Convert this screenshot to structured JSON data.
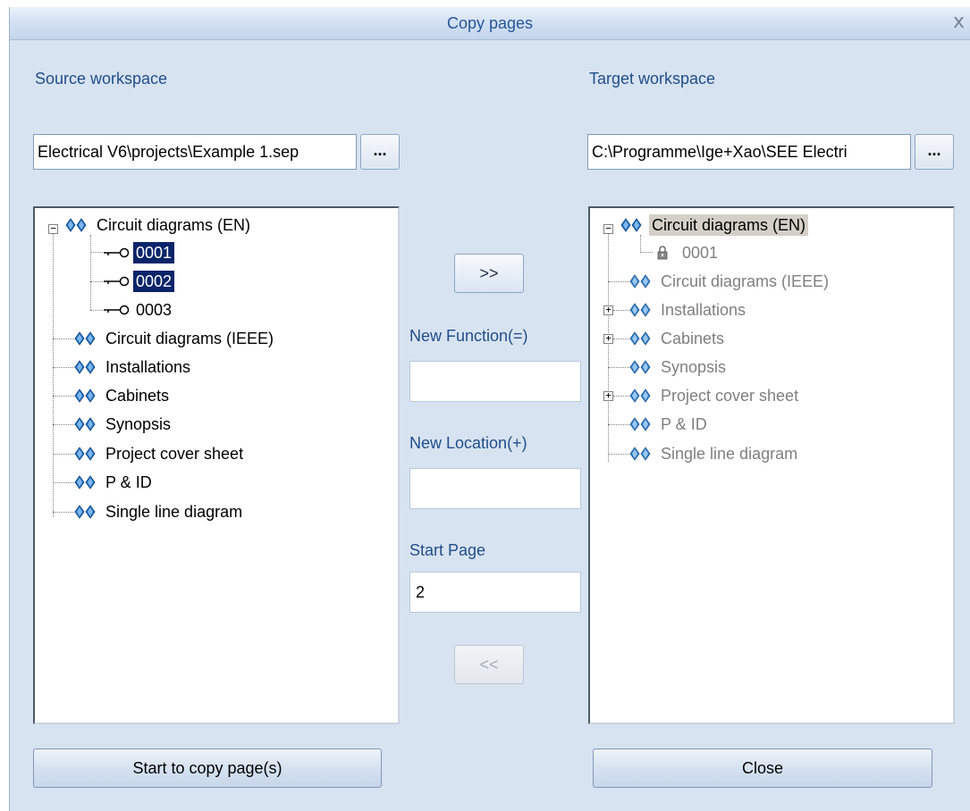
{
  "dialog": {
    "title": "Copy pages",
    "close_glyph": "x"
  },
  "source": {
    "label": "Source workspace",
    "path": "Electrical V6\\projects\\Example 1.sep",
    "browse_label": "...",
    "tree": {
      "root": "Circuit diagrams (EN)",
      "pages": [
        "0001",
        "0002",
        "0003"
      ],
      "items": [
        "Circuit diagrams (IEEE)",
        "Installations",
        "Cabinets",
        "Synopsis",
        "Project cover sheet",
        "P & ID",
        "Single line diagram"
      ]
    }
  },
  "target": {
    "label": "Target workspace",
    "path": "C:\\Programme\\Ige+Xao\\SEE Electri",
    "browse_label": "...",
    "tree": {
      "root": "Circuit diagrams (EN)",
      "pages": [
        "0001"
      ],
      "items": [
        "Circuit diagrams (IEEE)",
        "Installations",
        "Cabinets",
        "Synopsis",
        "Project cover sheet",
        "P & ID",
        "Single line diagram"
      ]
    }
  },
  "middle": {
    "add_label": ">>",
    "remove_label": "<<",
    "new_function_label": "New Function(=)",
    "new_function_value": "",
    "new_location_label": "New Location(+)",
    "new_location_value": "",
    "start_page_label": "Start Page",
    "start_page_value": "2"
  },
  "buttons": {
    "start_copy": "Start to copy page(s)",
    "close": "Close"
  },
  "icons": {
    "folder": "blue-diamond-pair-icon",
    "page": "page-key-icon",
    "locked_page": "lock-icon"
  },
  "colors": {
    "dialog_bg": "#d8e3f1",
    "label_blue": "#1f4e8c",
    "selection": "#0a246a"
  }
}
